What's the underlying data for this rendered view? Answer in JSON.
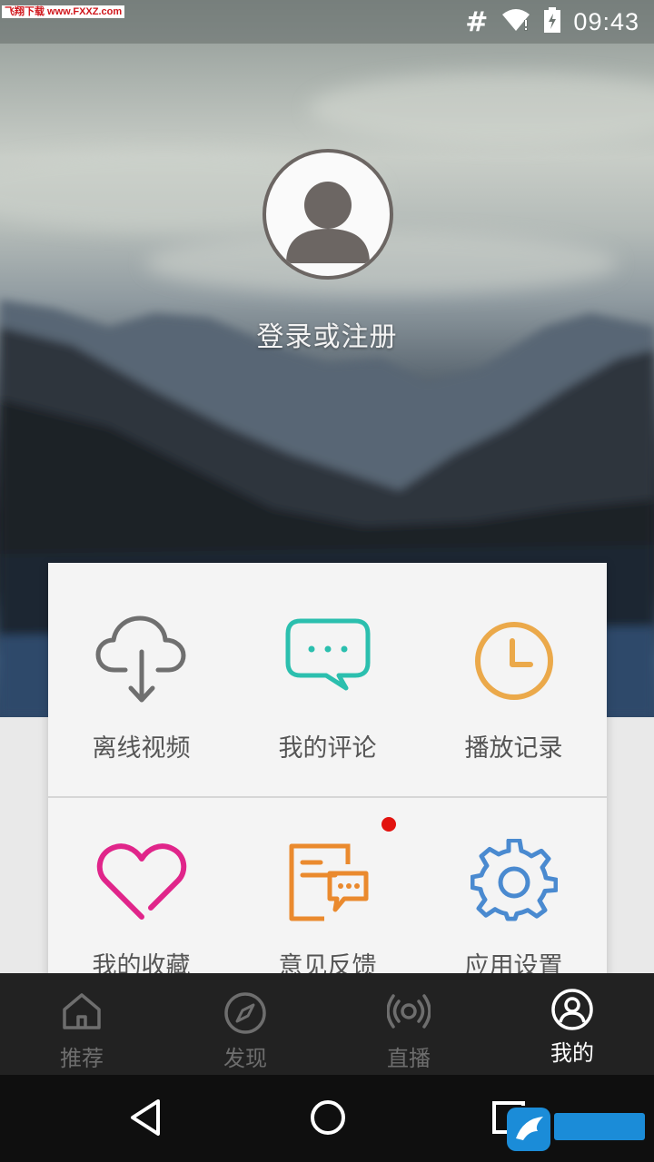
{
  "status_bar": {
    "watermark": "飞翔下载 www.FXXZ.com",
    "hash": "#",
    "time": "09:43",
    "icons": [
      "wifi-icon",
      "battery-icon"
    ]
  },
  "profile": {
    "login_label": "登录或注册",
    "avatar_icon": "default-user-icon"
  },
  "menu": {
    "items": [
      {
        "label": "离线视频",
        "icon": "cloud-download-icon",
        "color": "#6f6f6f"
      },
      {
        "label": "我的评论",
        "icon": "chat-bubble-icon",
        "color": "#2bbfae"
      },
      {
        "label": "播放记录",
        "icon": "clock-icon",
        "color": "#eba94a"
      },
      {
        "label": "我的收藏",
        "icon": "heart-icon",
        "color": "#e0258a"
      },
      {
        "label": "意见反馈",
        "icon": "feedback-icon",
        "color": "#ea8a2e"
      },
      {
        "label": "应用设置",
        "icon": "gear-icon",
        "color": "#4a8ad0"
      }
    ]
  },
  "tabs": [
    {
      "label": "推荐",
      "icon": "home-icon",
      "active": false
    },
    {
      "label": "发现",
      "icon": "compass-icon",
      "active": false
    },
    {
      "label": "直播",
      "icon": "broadcast-icon",
      "active": false
    },
    {
      "label": "我的",
      "icon": "user-circle-icon",
      "active": true
    }
  ],
  "nav": {
    "icons": [
      "back-icon",
      "home-circle-icon",
      "recents-icon"
    ]
  },
  "watermark_logo": "飞翔下载 www.FXXZ.com"
}
